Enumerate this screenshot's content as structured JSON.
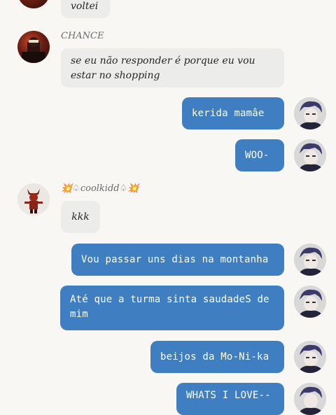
{
  "messages": {
    "top_partial": "voltei",
    "chance_name": "CHANCE",
    "chance_msg": "se eu não responder é porque eu vou estar no shopping",
    "me_1": "kerida mamâe",
    "me_2": "WOO-",
    "cool_name": "💥♤coolkidd♤💥",
    "cool_msg": "kkk",
    "me_3": "Vou passar uns dias na montanha",
    "me_4": "Até que a turma sinta saudadeS de mim",
    "me_5": "beijos da Mo-Ni-ka",
    "me_6": "WHATS I LOVE--"
  },
  "colors": {
    "outgoing": "#3f7fc1",
    "incoming": "#ececea",
    "background": "#f8f7f3"
  },
  "icons": [
    "chance-avatar",
    "coolkidd-avatar",
    "my-avatar"
  ]
}
